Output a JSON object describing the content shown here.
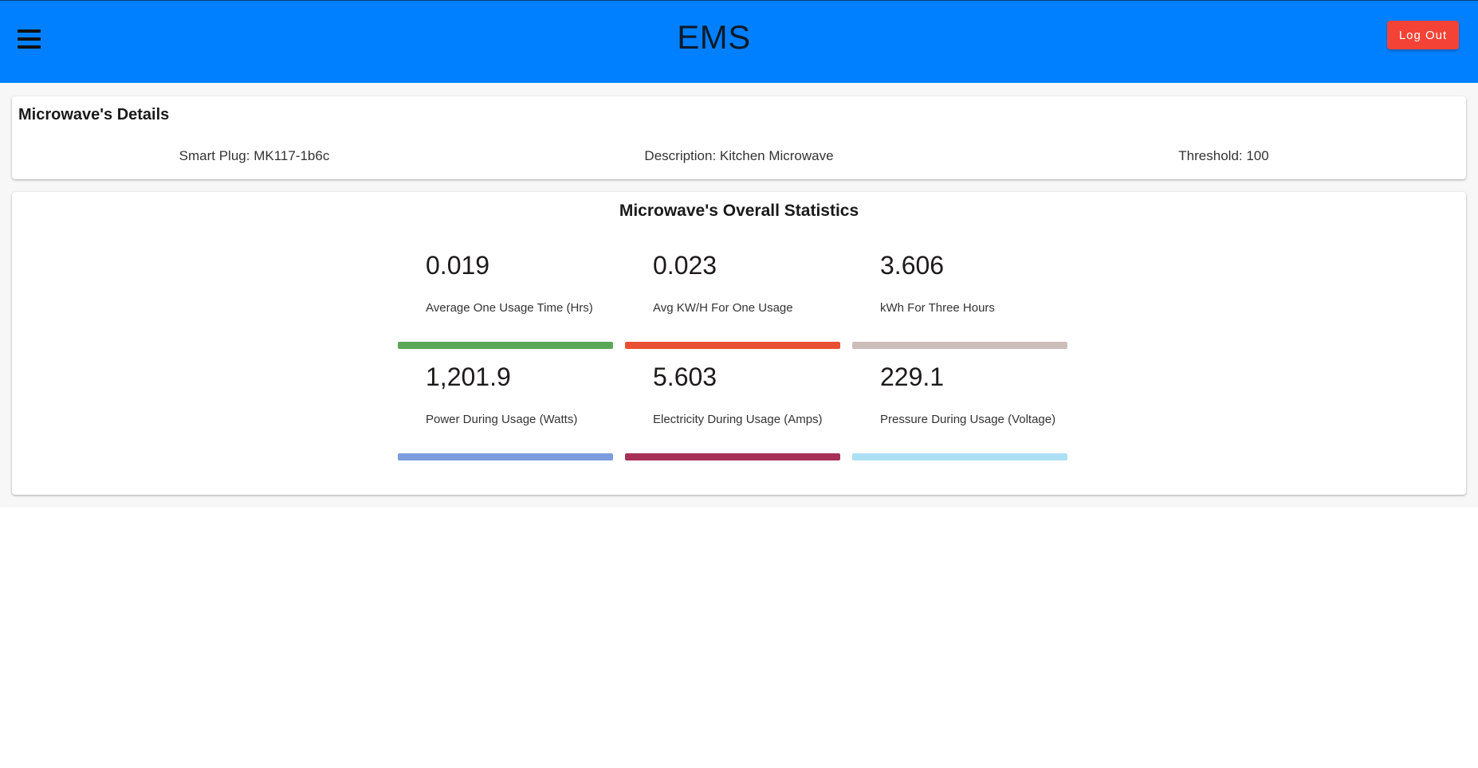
{
  "header": {
    "title": "EMS",
    "logout_label": "Log Out",
    "bar_color": "#0080ff",
    "logout_color": "#f44336"
  },
  "details": {
    "title": "Microwave's Details",
    "smart_plug": "Smart Plug: MK117-1b6c",
    "description": "Description: Kitchen Microwave",
    "threshold": "Threshold: 100"
  },
  "stats": {
    "title": "Microwave's Overall Statistics",
    "items": [
      {
        "value": "0.019",
        "label": "Average One Usage Time (Hrs)",
        "color": "#5aa757",
        "fill": 1.0
      },
      {
        "value": "0.023",
        "label": "Avg KW/H For One Usage",
        "color": "#e95033",
        "fill": 1.0
      },
      {
        "value": "3.606",
        "label": "kWh For Three Hours",
        "color": "#cdbdb8",
        "fill": 1.0
      },
      {
        "value": "1,201.9",
        "label": "Power During Usage (Watts)",
        "color": "#7b9ddd",
        "fill": 1.0
      },
      {
        "value": "5.603",
        "label": "Electricity During Usage (Amps)",
        "color": "#a73256",
        "fill": 1.0
      },
      {
        "value": "229.1",
        "label": "Pressure During Usage (Voltage)",
        "color": "#ade0f5",
        "fill": 1.0
      }
    ]
  }
}
